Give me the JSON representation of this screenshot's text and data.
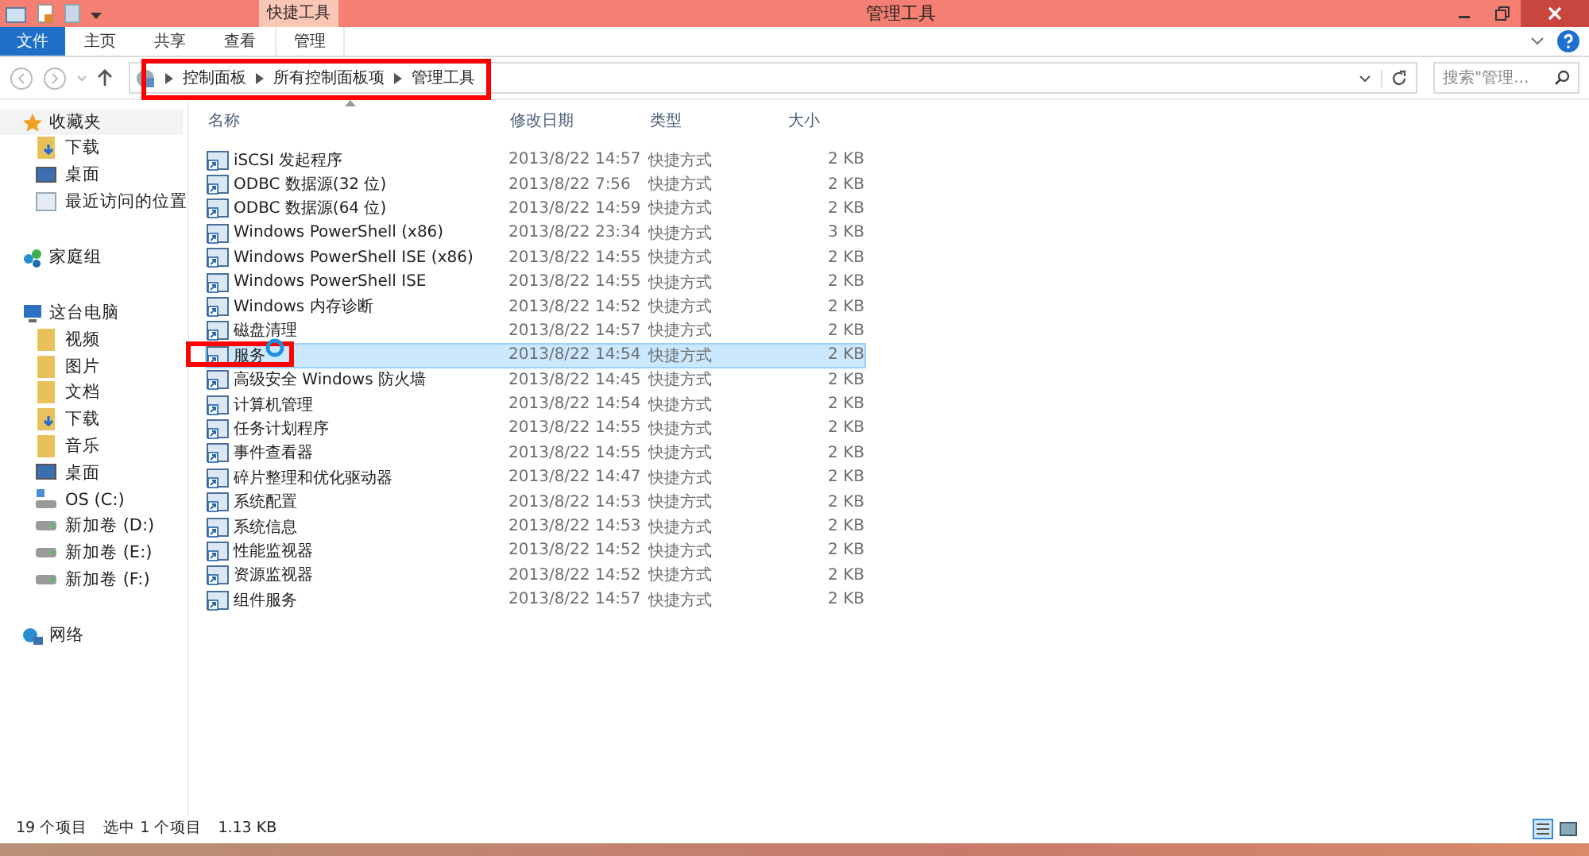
{
  "window": {
    "title": "管理工具",
    "context_tab": "快捷工具"
  },
  "ribbon_tabs": [
    {
      "label": "文件",
      "kind": "file",
      "selected": false
    },
    {
      "label": "主页",
      "kind": "tab",
      "selected": false
    },
    {
      "label": "共享",
      "kind": "tab",
      "selected": false
    },
    {
      "label": "查看",
      "kind": "tab",
      "selected": false
    },
    {
      "label": "管理",
      "kind": "context",
      "selected": false
    }
  ],
  "breadcrumb": [
    "控制面板",
    "所有控制面板项",
    "管理工具"
  ],
  "search": {
    "placeholder": "搜索\"管理..."
  },
  "navigation": [
    {
      "label": "收藏夹",
      "kind": "star",
      "selected": true,
      "children": [
        {
          "label": "下载",
          "kind": "download"
        },
        {
          "label": "桌面",
          "kind": "desktop"
        },
        {
          "label": "最近访问的位置",
          "kind": "recent"
        }
      ]
    },
    {
      "label": "家庭组",
      "kind": "homegroup",
      "selected": false
    },
    {
      "label": "这台电脑",
      "kind": "pc",
      "selected": false,
      "children": [
        {
          "label": "视频",
          "kind": "folder"
        },
        {
          "label": "图片",
          "kind": "folder"
        },
        {
          "label": "文档",
          "kind": "folder"
        },
        {
          "label": "下载",
          "kind": "download"
        },
        {
          "label": "音乐",
          "kind": "folder"
        },
        {
          "label": "桌面",
          "kind": "desktop"
        },
        {
          "label": "OS (C:)",
          "kind": "osdrive"
        },
        {
          "label": "新加卷 (D:)",
          "kind": "drive"
        },
        {
          "label": "新加卷 (E:)",
          "kind": "drive"
        },
        {
          "label": "新加卷 (F:)",
          "kind": "drive"
        }
      ]
    },
    {
      "label": "网络",
      "kind": "network",
      "selected": false
    }
  ],
  "table": {
    "columns": [
      "名称",
      "修改日期",
      "类型",
      "大小"
    ],
    "rows": [
      {
        "name": "iSCSI 发起程序",
        "date": "2013/8/22 14:57",
        "type": "快捷方式",
        "size": "2 KB",
        "selected": false
      },
      {
        "name": "ODBC 数据源(32 位)",
        "date": "2013/8/22 7:56",
        "type": "快捷方式",
        "size": "2 KB",
        "selected": false
      },
      {
        "name": "ODBC 数据源(64 位)",
        "date": "2013/8/22 14:59",
        "type": "快捷方式",
        "size": "2 KB",
        "selected": false
      },
      {
        "name": "Windows PowerShell (x86)",
        "date": "2013/8/22 23:34",
        "type": "快捷方式",
        "size": "3 KB",
        "selected": false
      },
      {
        "name": "Windows PowerShell ISE (x86)",
        "date": "2013/8/22 14:55",
        "type": "快捷方式",
        "size": "2 KB",
        "selected": false
      },
      {
        "name": "Windows PowerShell ISE",
        "date": "2013/8/22 14:55",
        "type": "快捷方式",
        "size": "2 KB",
        "selected": false
      },
      {
        "name": "Windows 内存诊断",
        "date": "2013/8/22 14:52",
        "type": "快捷方式",
        "size": "2 KB",
        "selected": false
      },
      {
        "name": "磁盘清理",
        "date": "2013/8/22 14:57",
        "type": "快捷方式",
        "size": "2 KB",
        "selected": false
      },
      {
        "name": "服务",
        "date": "2013/8/22 14:54",
        "type": "快捷方式",
        "size": "2 KB",
        "selected": true
      },
      {
        "name": "高级安全 Windows 防火墙",
        "date": "2013/8/22 14:45",
        "type": "快捷方式",
        "size": "2 KB",
        "selected": false
      },
      {
        "name": "计算机管理",
        "date": "2013/8/22 14:54",
        "type": "快捷方式",
        "size": "2 KB",
        "selected": false
      },
      {
        "name": "任务计划程序",
        "date": "2013/8/22 14:55",
        "type": "快捷方式",
        "size": "2 KB",
        "selected": false
      },
      {
        "name": "事件查看器",
        "date": "2013/8/22 14:55",
        "type": "快捷方式",
        "size": "2 KB",
        "selected": false
      },
      {
        "name": "碎片整理和优化驱动器",
        "date": "2013/8/22 14:47",
        "type": "快捷方式",
        "size": "2 KB",
        "selected": false
      },
      {
        "name": "系统配置",
        "date": "2013/8/22 14:53",
        "type": "快捷方式",
        "size": "2 KB",
        "selected": false
      },
      {
        "name": "系统信息",
        "date": "2013/8/22 14:53",
        "type": "快捷方式",
        "size": "2 KB",
        "selected": false
      },
      {
        "name": "性能监视器",
        "date": "2013/8/22 14:52",
        "type": "快捷方式",
        "size": "2 KB",
        "selected": false
      },
      {
        "name": "资源监视器",
        "date": "2013/8/22 14:52",
        "type": "快捷方式",
        "size": "2 KB",
        "selected": false
      },
      {
        "name": "组件服务",
        "date": "2013/8/22 14:57",
        "type": "快捷方式",
        "size": "2 KB",
        "selected": false
      }
    ]
  },
  "status_bar": {
    "count": "19 个项目",
    "selection": "选中 1 个项目",
    "size": "1.13 KB"
  }
}
